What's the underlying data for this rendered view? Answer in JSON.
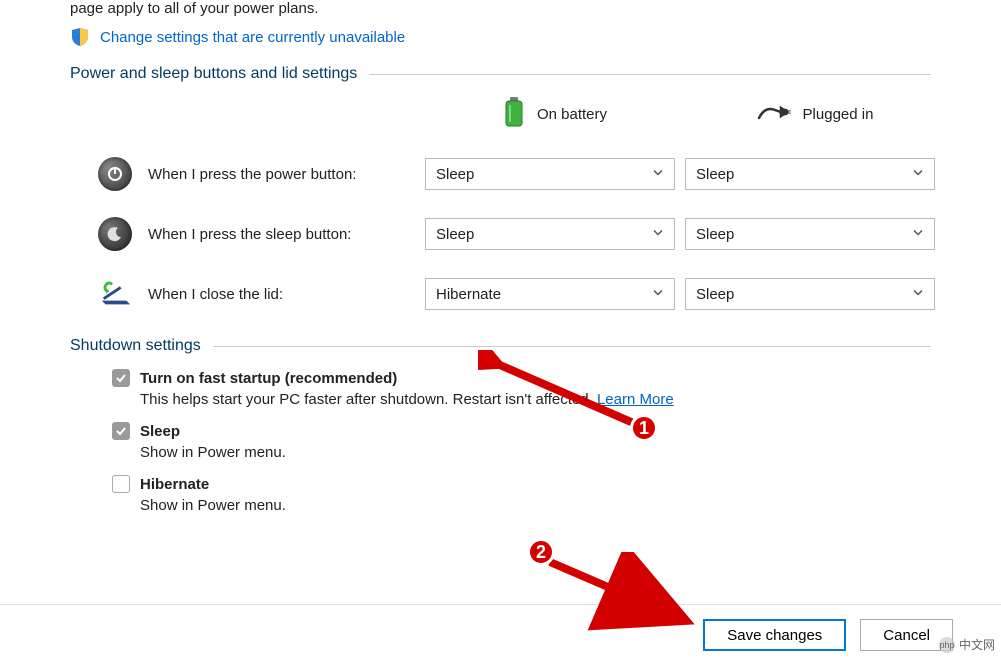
{
  "intro_text": "page apply to all of your power plans.",
  "change_settings_link": "Change settings that are currently unavailable",
  "section_power": "Power and sleep buttons and lid settings",
  "headers": {
    "battery": "On battery",
    "plugged": "Plugged in"
  },
  "rows": {
    "power_button": {
      "label": "When I press the power button:",
      "battery": "Sleep",
      "plugged": "Sleep"
    },
    "sleep_button": {
      "label": "When I press the sleep button:",
      "battery": "Sleep",
      "plugged": "Sleep"
    },
    "close_lid": {
      "label": "When I close the lid:",
      "battery": "Hibernate",
      "plugged": "Sleep"
    }
  },
  "section_shutdown": "Shutdown settings",
  "shutdown_items": {
    "fast_startup": {
      "label": "Turn on fast startup (recommended)",
      "desc_pre": "This helps start your PC faster after shutdown. Restart isn't affected. ",
      "learn_more": "Learn More"
    },
    "sleep": {
      "label": "Sleep",
      "desc": "Show in Power menu."
    },
    "hibernate": {
      "label": "Hibernate",
      "desc": "Show in Power menu."
    }
  },
  "buttons": {
    "save": "Save changes",
    "cancel": "Cancel"
  },
  "callouts": {
    "one": "1",
    "two": "2"
  },
  "watermark": {
    "logo": "php",
    "text": "中文网"
  }
}
